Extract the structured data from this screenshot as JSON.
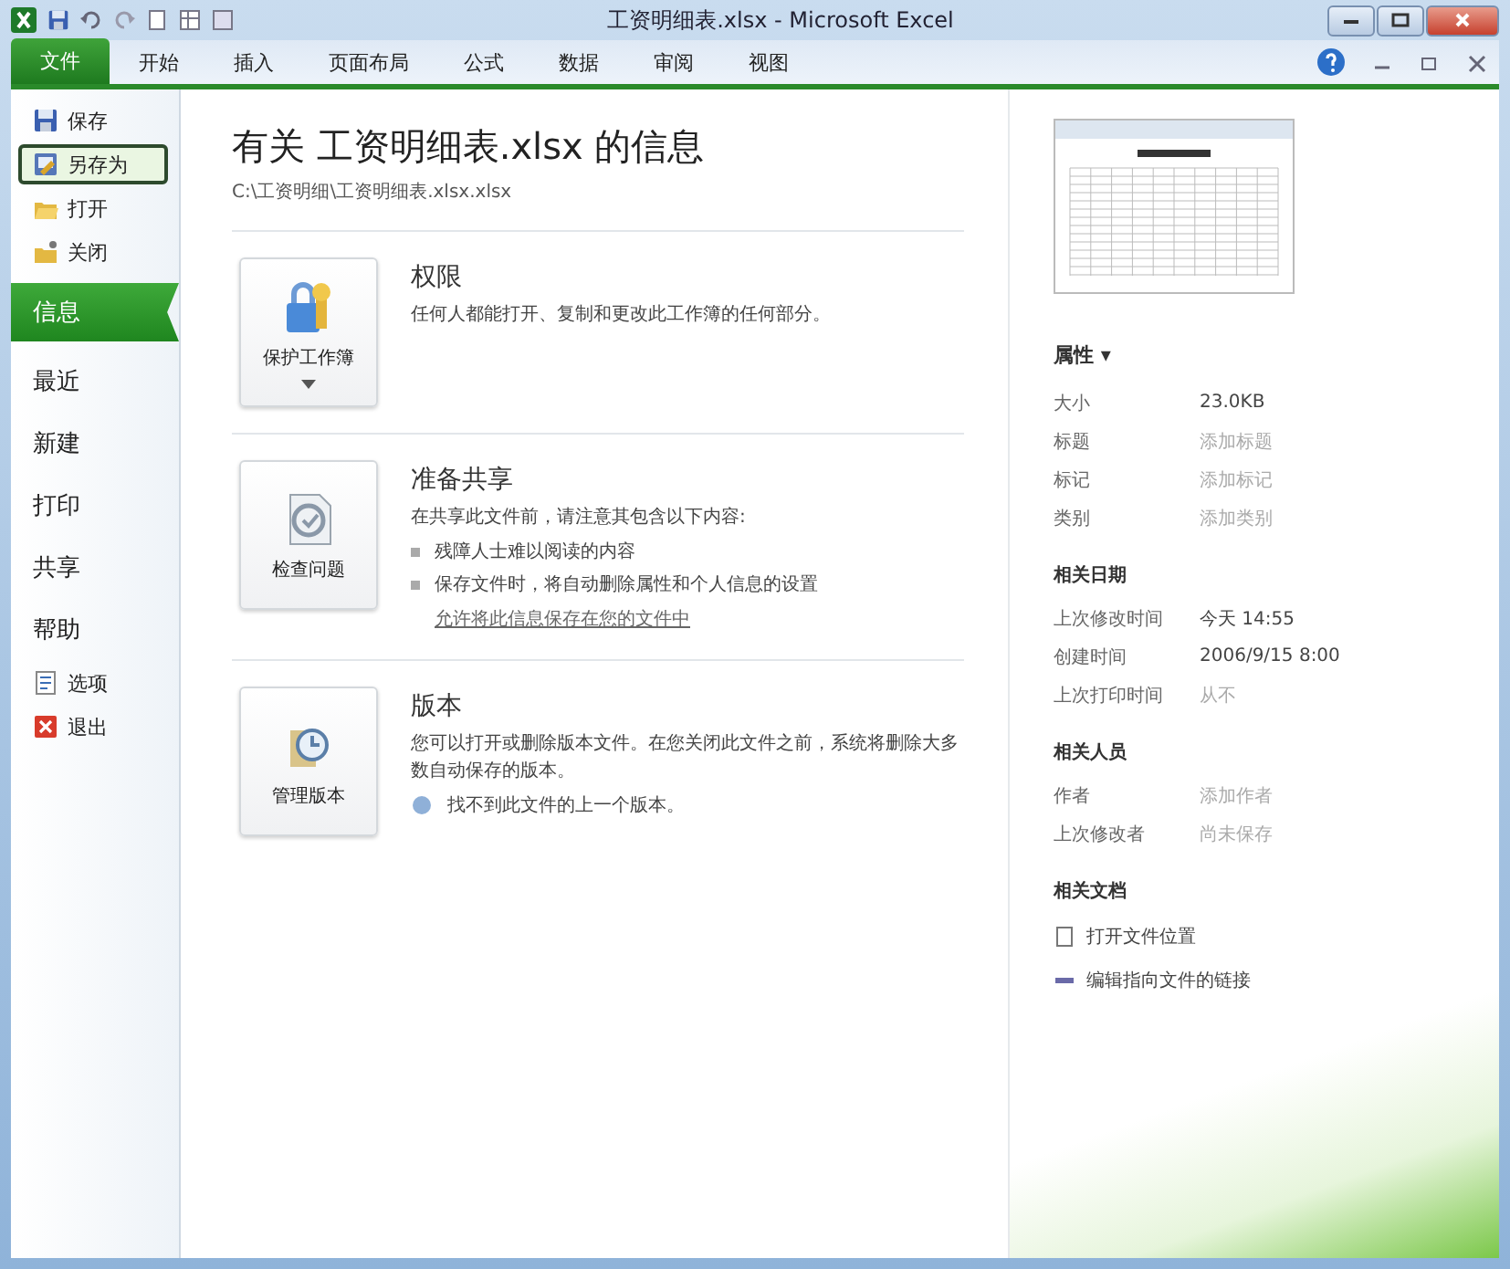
{
  "window": {
    "title": "工资明细表.xlsx - Microsoft Excel"
  },
  "ribbon_tabs": [
    {
      "label": "文件",
      "selected": true
    },
    {
      "label": "开始",
      "selected": false
    },
    {
      "label": "插入",
      "selected": false
    },
    {
      "label": "页面布局",
      "selected": false
    },
    {
      "label": "公式",
      "selected": false
    },
    {
      "label": "数据",
      "selected": false
    },
    {
      "label": "审阅",
      "selected": false
    },
    {
      "label": "视图",
      "selected": false
    }
  ],
  "sidebar": {
    "items": [
      {
        "kind": "command",
        "label": "保存",
        "hovered": false
      },
      {
        "kind": "command",
        "label": "另存为",
        "hovered": true
      },
      {
        "kind": "command",
        "label": "打开",
        "hovered": false
      },
      {
        "kind": "command",
        "label": "关闭",
        "hovered": false
      },
      {
        "kind": "page",
        "label": "信息",
        "selected": true
      },
      {
        "kind": "page",
        "label": "最近",
        "selected": false
      },
      {
        "kind": "page",
        "label": "新建",
        "selected": false
      },
      {
        "kind": "page",
        "label": "打印",
        "selected": false
      },
      {
        "kind": "page",
        "label": "共享",
        "selected": false
      },
      {
        "kind": "page",
        "label": "帮助",
        "selected": false
      },
      {
        "kind": "command",
        "label": "选项",
        "hovered": false
      },
      {
        "kind": "command",
        "label": "退出",
        "hovered": false
      }
    ]
  },
  "info": {
    "heading": "有关 工资明细表.xlsx 的信息",
    "path": "C:\\工资明细\\工资明细表.xlsx.xlsx",
    "sections": [
      {
        "button": "保护工作簿",
        "dropdown": true,
        "title": "权限",
        "text": "任何人都能打开、复制和更改此工作簿的任何部分。"
      },
      {
        "button": "检查问题",
        "dropdown": false,
        "title": "准备共享",
        "text": "在共享此文件前，请注意其包含以下内容:",
        "bullets": [
          "残障人士难以阅读的内容",
          "保存文件时，将自动删除属性和个人信息的设置"
        ],
        "link": "允许将此信息保存在您的文件中"
      },
      {
        "button": "管理版本",
        "dropdown": false,
        "title": "版本",
        "text": "您可以打开或删除版本文件。在您关闭此文件之前，系统将删除大多数自动保存的版本。",
        "note": "找不到此文件的上一个版本。"
      }
    ]
  },
  "properties": {
    "heading": "属性 ▾",
    "groups": [
      {
        "rows": [
          {
            "label": "大小",
            "value": "23.0KB",
            "placeholder": false
          },
          {
            "label": "标题",
            "value": "添加标题",
            "placeholder": true
          },
          {
            "label": "标记",
            "value": "添加标记",
            "placeholder": true
          },
          {
            "label": "类别",
            "value": "添加类别",
            "placeholder": true
          }
        ]
      },
      {
        "title": "相关日期",
        "rows": [
          {
            "label": "上次修改时间",
            "value": "今天 14:55",
            "placeholder": false
          },
          {
            "label": "创建时间",
            "value": "2006/9/15 8:00",
            "placeholder": false
          },
          {
            "label": "上次打印时间",
            "value": "从不",
            "placeholder": true
          }
        ]
      },
      {
        "title": "相关人员",
        "rows": [
          {
            "label": "作者",
            "value": "添加作者",
            "placeholder": true
          },
          {
            "label": "上次修改者",
            "value": "尚未保存",
            "placeholder": true
          }
        ]
      }
    ],
    "documents": {
      "title": "相关文档",
      "links": [
        {
          "label": "打开文件位置"
        },
        {
          "label": "编辑指向文件的链接"
        }
      ]
    }
  }
}
